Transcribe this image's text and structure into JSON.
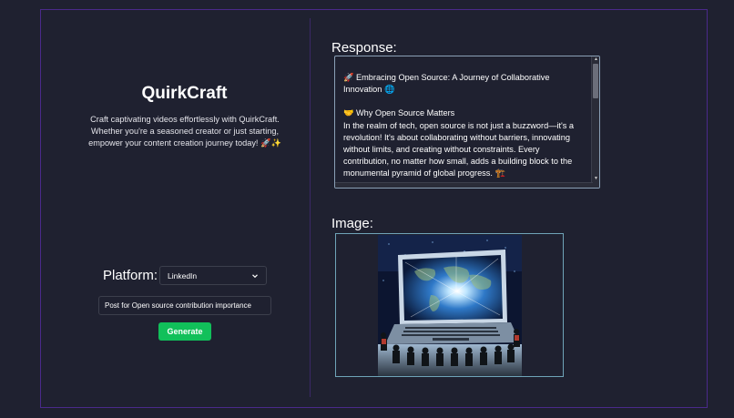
{
  "app": {
    "title": "QuirkCraft",
    "description": "Craft captivating videos effortlessly with QuirkCraft. Whether you're a seasoned creator or just starting, empower your content creation journey today! 🚀✨"
  },
  "form": {
    "platform_label": "Platform:",
    "platform_selected": "LinkedIn",
    "topic_value": "Post for Open source contribution importance",
    "generate_label": "Generate"
  },
  "response": {
    "label": "Response:",
    "heading": "🚀 Embracing Open Source: A Journey of Collaborative Innovation 🌐",
    "subheading": "🤝 Why Open Source Matters",
    "body": "In the realm of tech, open source is not just a buzzword—it's a revolution! It's about collaborating without barriers, innovating without limits, and creating without constraints. Every contribution, no matter how small, adds a building block to the monumental pyramid of global progress. 🏗️"
  },
  "image": {
    "label": "Image:",
    "subject": "laptop-world-map-illustration"
  },
  "colors": {
    "background": "#1f2130",
    "frame_border": "#4a2a8a",
    "generate_button": "#11c05a",
    "response_border": "#8aa0b6",
    "image_border": "#6fa4b8"
  }
}
